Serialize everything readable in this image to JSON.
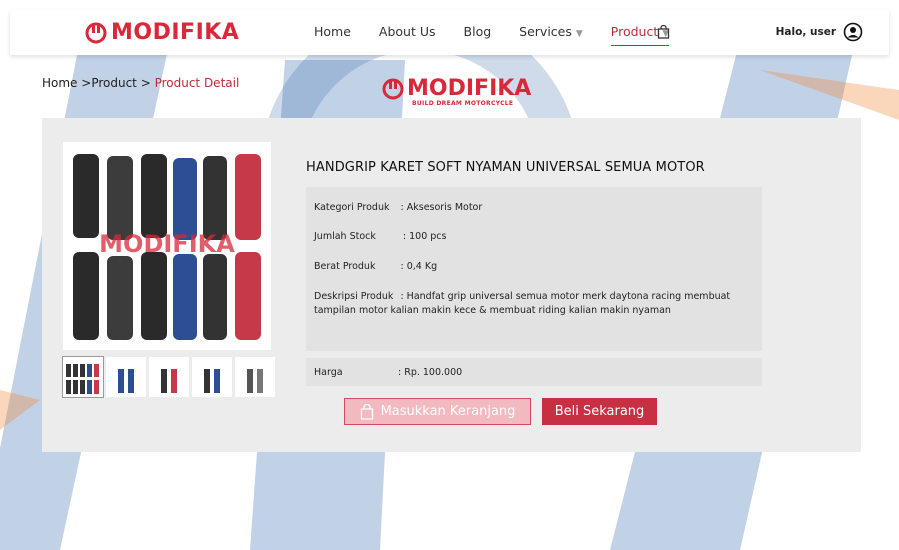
{
  "brand": {
    "name": "MODIFIKA",
    "tagline": "BUILD DREAM MOTORCYCLE",
    "color": "#d8283a"
  },
  "nav": {
    "items": [
      {
        "label": "Home"
      },
      {
        "label": "About Us"
      },
      {
        "label": "Blog"
      },
      {
        "label": "Services"
      },
      {
        "label": "Product"
      }
    ],
    "greeting": "Halo, user"
  },
  "breadcrumb": {
    "home": "Home",
    "sep1": " >",
    "product": "Product",
    "sep2": " > ",
    "current": "Product Detail"
  },
  "product": {
    "title": "HANDGRIP KARET SOFT NYAMAN UNIVERSAL SEMUA MOTOR",
    "category_label": "Kategori Produk",
    "category_value": ": Aksesoris Motor",
    "stock_label": "Jumlah Stock",
    "stock_value": ": 100 pcs",
    "weight_label": "Berat Produk",
    "weight_value": ": 0,4 Kg",
    "desc_label": "Deskripsi Produk",
    "desc_value": ": Handfat grip universal semua motor merk daytona racing membuat tampilan motor kalian makin kece & membuat riding kalian makin nyaman",
    "price_label": "Harga",
    "price_value": ": Rp. 100.000",
    "image_watermark": "MODIFIKA"
  },
  "actions": {
    "add_to_cart": "Masukkan Keranjang",
    "buy_now": "Beli Sekarang"
  },
  "colors": {
    "accent": "#c2293b",
    "panel": "#ececec",
    "button_buy": "#c82f43",
    "button_cart": "#f2b9c0"
  }
}
